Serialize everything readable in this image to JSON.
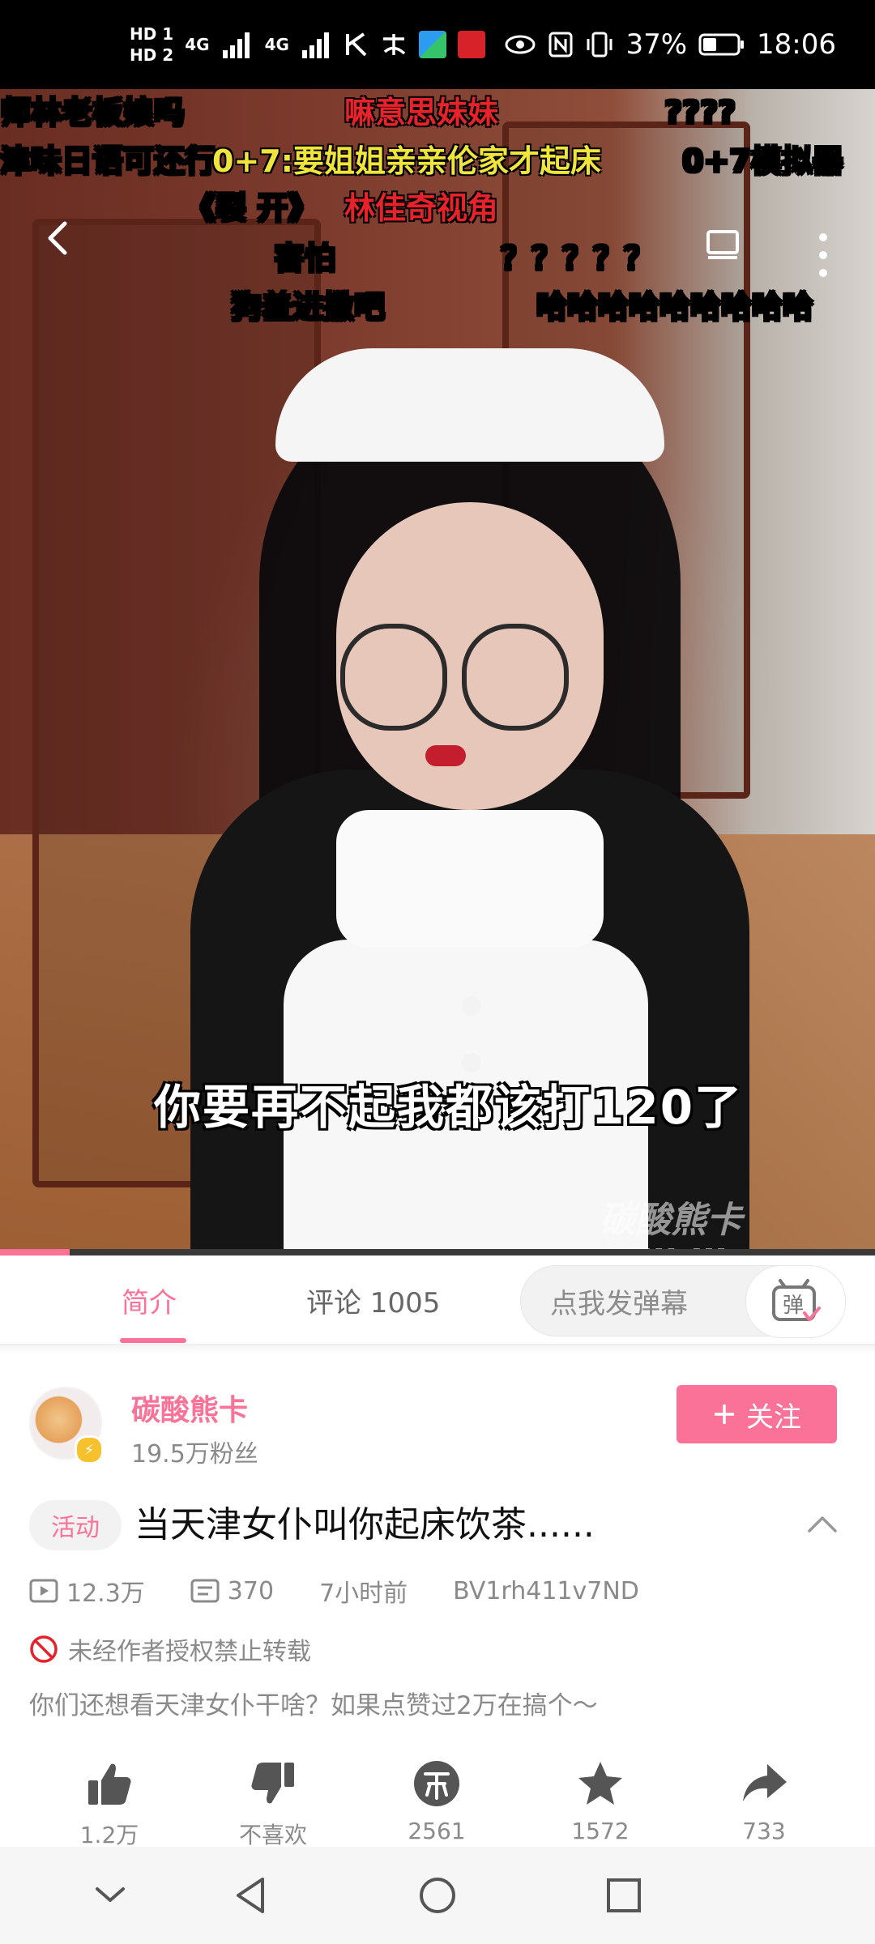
{
  "status_bar": {
    "time": "18:06",
    "battery": "37%",
    "network_top": "HD 1",
    "network_bottom": "HD 2",
    "sig1": "4G",
    "sig2": "4G"
  },
  "video": {
    "danmaku": [
      {
        "text": "师林老板娘吗",
        "color": "#ffffff"
      },
      {
        "text": "嘛意思妹妹",
        "color": "#e8222a"
      },
      {
        "text": "????",
        "color": "#ffffff"
      },
      {
        "text": "津味日语可还行",
        "color": "#ffffff"
      },
      {
        "text": "0+7:要姐姐亲亲伦家才起床",
        "color": "#f0e53a"
      },
      {
        "text": "0+7模拟器",
        "color": "#ffffff"
      },
      {
        "text": "《裂 开》",
        "color": "#ffffff"
      },
      {
        "text": "林佳奇视角",
        "color": "#e8222a"
      },
      {
        "text": "害怕",
        "color": "#ffffff"
      },
      {
        "text": "？？？？？",
        "color": "#ffffff"
      },
      {
        "text": "狗羞进撒吧",
        "color": "#ffffff"
      },
      {
        "text": "哈哈哈哈哈哈哈哈哈",
        "color": "#ffffff"
      }
    ],
    "subtitle": "你要再不起我都该打120了",
    "watermark": "碳酸熊卡 bilibili",
    "progress": 0.08
  },
  "tabs": {
    "intro": "简介",
    "comments": "评论 1005",
    "danmaku_placeholder": "点我发弹幕",
    "danmaku_toggle_label": "弹"
  },
  "uploader": {
    "name": "碳酸熊卡",
    "fans": "19.5万粉丝",
    "follow_label": "关注"
  },
  "video_info": {
    "tag": "活动",
    "title": "当天津女仆叫你起床饮茶......",
    "views": "12.3万",
    "danmaku_count": "370",
    "time_ago": "7小时前",
    "bvid": "BV1rh411v7ND",
    "warning": "未经作者授权禁止转载",
    "description": "你们还想看天津女仆干啥？如果点赞过2万在搞个～"
  },
  "actions": [
    {
      "icon": "thumbs-up-icon",
      "label": "1.2万"
    },
    {
      "icon": "thumbs-down-icon",
      "label": "不喜欢"
    },
    {
      "icon": "coin-icon",
      "label": "2561"
    },
    {
      "icon": "star-icon",
      "label": "1572"
    },
    {
      "icon": "share-icon",
      "label": "733"
    }
  ],
  "colors": {
    "accent": "#fb7299",
    "muted_text": "#8a8a8a",
    "status_bg": "#000000"
  }
}
